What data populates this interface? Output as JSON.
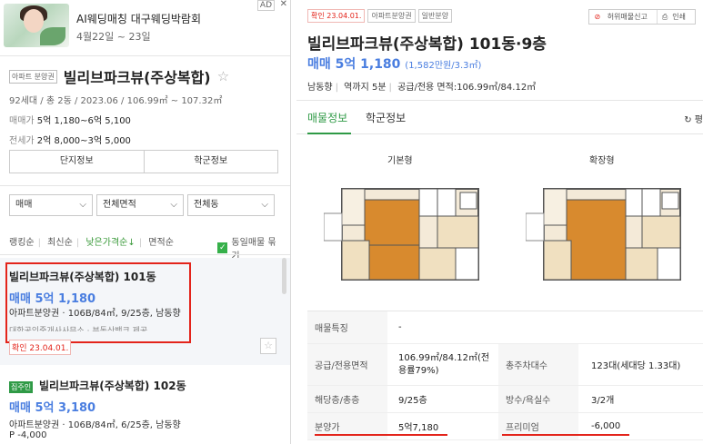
{
  "ad": {
    "title": "AI웨딩매칭 대구웨딩박람회",
    "date": "4월22일 ~ 23일",
    "badge": "AD",
    "close": "✕"
  },
  "complex": {
    "tag": "아파트 분양권",
    "name": "빌리브파크뷰(주상복합)",
    "meta": "92세대 / 총 2동 / 2023.06 / 106.99㎡ ~ 107.32㎡",
    "sale_label": "매매가",
    "sale_value": "5억 1,180~6억 5,100",
    "rent_label": "전세가",
    "rent_value": "2억 8,000~3억 5,000",
    "btn_info": "단지정보",
    "btn_school": "학군정보"
  },
  "filters": {
    "trade": "매매",
    "area": "전체면적",
    "dong": "전체동"
  },
  "sorts": {
    "rank": "랭킹순",
    "latest": "최신순",
    "low_price": "낮은가격순↓",
    "area": "면적순",
    "same": "동일매물 묶기"
  },
  "listing1": {
    "name": "빌리브파크뷰(주상복합) 101동",
    "price": "매매 5억 1,180",
    "desc": "아파트분양권 · 106B/84㎡, 9/25층, 남동향",
    "agent": "대한공인중개사사무소 · 부동산뱅크 제공",
    "confirm": "확인 23.04.01."
  },
  "listing2": {
    "badge": "집주인",
    "name": "빌리브파크뷰(주상복합) 102동",
    "price": "매매 5억 3,180",
    "desc": "아파트분양권 · 106B/84㎡, 6/25층, 남동향",
    "premium": "P -4,000"
  },
  "detail": {
    "tags": [
      "확인 23.04.01.",
      "아파트분양권",
      "일반분양"
    ],
    "report": "허위매물신고",
    "print": "인쇄",
    "title": "빌리브파크뷰(주상복합) 101동·9층",
    "price": "매매 5억 1,180",
    "price_per": "(1,582만원/3.3㎡)",
    "direction": "남동향",
    "station": "역까지 5분",
    "area": "공급/전용 면적:106.99㎡/84.12㎡",
    "tab_info": "매물정보",
    "tab_school": "학군정보",
    "refresh": "↻ 평",
    "fp_basic": "기본형",
    "fp_ext": "확장형"
  },
  "table": [
    {
      "k": "매물특징",
      "v": "-",
      "k2": "",
      "v2": ""
    },
    {
      "k": "공급/전용면적",
      "v": "106.99㎡/84.12㎡(전용률79%)",
      "k2": "총주차대수",
      "v2": "123대(세대당 1.33대)"
    },
    {
      "k": "해당층/총층",
      "v": "9/25층",
      "k2": "방수/욕실수",
      "v2": "3/2개"
    },
    {
      "k": "분양가",
      "v": "5억7,180",
      "k2": "프리미엄",
      "v2": "-6,000"
    }
  ]
}
